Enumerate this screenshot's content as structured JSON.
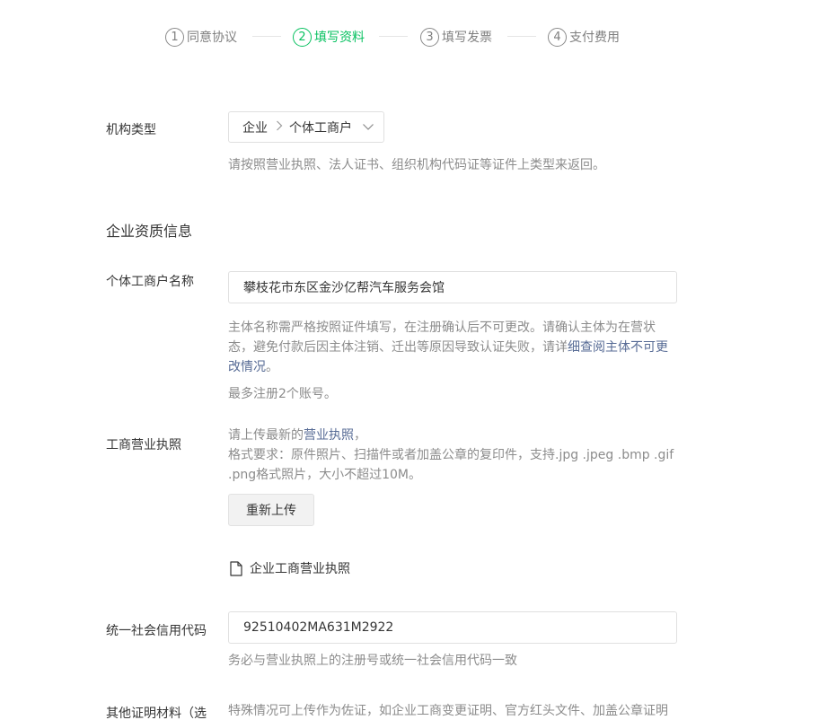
{
  "steps": [
    {
      "num": "1",
      "label": "同意协议",
      "state": "done"
    },
    {
      "num": "2",
      "label": "填写资料",
      "state": "active"
    },
    {
      "num": "3",
      "label": "填写发票",
      "state": "todo"
    },
    {
      "num": "4",
      "label": "支付费用",
      "state": "todo"
    }
  ],
  "colors": {
    "accent": "#07c160",
    "link": "#576b95",
    "tip": "#8c8c8c"
  },
  "org_type": {
    "label": "机构类型",
    "value_1": "企业",
    "value_2": "个体工商户",
    "tip": "请按照营业执照、法人证书、组织机构代码证等证件上类型来返回。"
  },
  "section_title": "企业资质信息",
  "name_field": {
    "label": "个体工商户名称",
    "value": "攀枝花市东区金沙亿帮汽车服务会馆",
    "tip_text": "主体名称需严格按照证件填写，在注册确认后不可更改。请确认主体为在营状态，避免付款后因主体注销、迁出等原因导致认证失败，请详",
    "tip_link": "细查阅主体不可更改情况",
    "tip_end": "。",
    "limit": "最多注册2个账号。"
  },
  "license": {
    "label": "工商营业执照",
    "tip_line1_pre": "请上传最新的",
    "tip_line1_link": "营业执照",
    "tip_line1_post": "，",
    "tip_rest": "格式要求：原件照片、扫描件或者加盖公章的复印件，支持.jpg .jpeg .bmp .gif .png格式照片，大小不超过10M。",
    "reupload_button": "重新上传",
    "file_name": "企业工商营业执照",
    "file_icon": "file-icon"
  },
  "credit_code": {
    "label": "统一社会信用代码",
    "value": "92510402MA631M2922",
    "tip": "务必与营业执照上的注册号或统一社会信用代码一致"
  },
  "other_docs": {
    "label": "其他证明材料（选",
    "tip": "特殊情况可上传作为佐证，如企业工商变更证明、官方红头文件、加盖公章证明"
  }
}
